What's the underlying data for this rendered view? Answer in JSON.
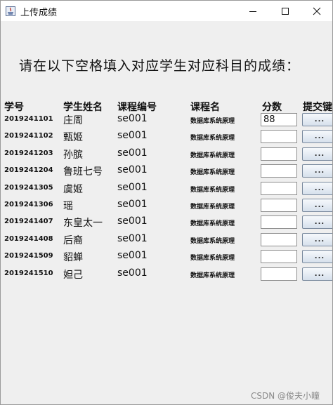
{
  "window": {
    "title": "上传成绩",
    "icon": "java-app-icon",
    "controls": [
      "minimize-icon",
      "maximize-icon",
      "close-icon"
    ]
  },
  "instruction": "请在以下空格填入对应学生对应科目的成绩：",
  "columns": [
    "学号",
    "学生姓名",
    "课程编号",
    "课程名",
    "分数",
    "提交键"
  ],
  "rows": [
    {
      "id": "2019241101",
      "name": "庄周",
      "code": "se001",
      "course": "数据库系统原理",
      "score": "88",
      "button": "..."
    },
    {
      "id": "2019241102",
      "name": "甄姬",
      "code": "se001",
      "course": "数据库系统原理",
      "score": "",
      "button": "..."
    },
    {
      "id": "2019241203",
      "name": "孙膑",
      "code": "se001",
      "course": "数据库系统原理",
      "score": "",
      "button": "..."
    },
    {
      "id": "2019241204",
      "name": "鲁班七号",
      "code": "se001",
      "course": "数据库系统原理",
      "score": "",
      "button": "..."
    },
    {
      "id": "2019241305",
      "name": "虞姬",
      "code": "se001",
      "course": "数据库系统原理",
      "score": "",
      "button": "..."
    },
    {
      "id": "2019241306",
      "name": "瑶",
      "code": "se001",
      "course": "数据库系统原理",
      "score": "",
      "button": "..."
    },
    {
      "id": "2019241407",
      "name": "东皇太一",
      "code": "se001",
      "course": "数据库系统原理",
      "score": "",
      "button": "..."
    },
    {
      "id": "2019241408",
      "name": "后裔",
      "code": "se001",
      "course": "数据库系统原理",
      "score": "",
      "button": "..."
    },
    {
      "id": "2019241509",
      "name": "貂蝉",
      "code": "se001",
      "course": "数据库系统原理",
      "score": "",
      "button": "..."
    },
    {
      "id": "2019241510",
      "name": "妲己",
      "code": "se001",
      "course": "数据库系统原理",
      "score": "",
      "button": "..."
    }
  ],
  "watermark": "CSDN @俊夫小瞳",
  "colors": {
    "window_bg": "#efefef",
    "titlebar_bg": "#ffffff",
    "button_gradient_top": "#f6f9fc",
    "button_gradient_bottom": "#d6e0ec",
    "watermark": "#8a8a8a"
  }
}
